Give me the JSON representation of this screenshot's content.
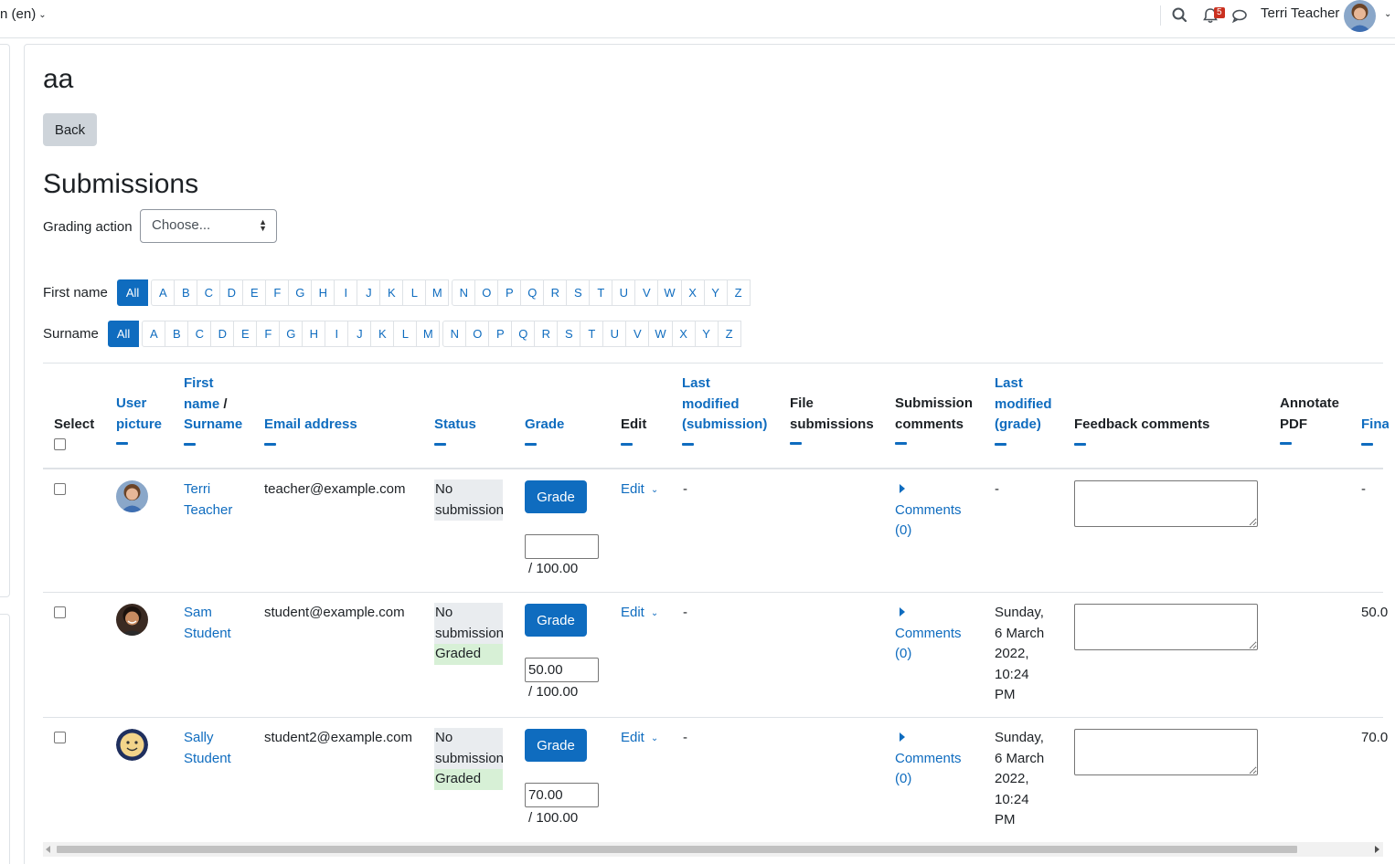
{
  "navbar": {
    "language": "n (en)",
    "notification_count": "5",
    "user_name": "Terri Teacher",
    "icons": [
      "search-icon",
      "bell-icon",
      "chat-icon",
      "chevron-down-icon"
    ]
  },
  "page": {
    "title": "aa",
    "back_label": "Back",
    "section_title": "Submissions",
    "grading_action_label": "Grading action",
    "grading_action_value": "Choose..."
  },
  "filters": {
    "first_name_label": "First name",
    "surname_label": "Surname",
    "all_label": "All",
    "letters": [
      "A",
      "B",
      "C",
      "D",
      "E",
      "F",
      "G",
      "H",
      "I",
      "J",
      "K",
      "L",
      "M",
      "N",
      "O",
      "P",
      "Q",
      "R",
      "S",
      "T",
      "U",
      "V",
      "W",
      "X",
      "Y",
      "Z"
    ]
  },
  "table": {
    "headers": {
      "select": "Select",
      "user_picture": [
        "User",
        "picture"
      ],
      "name": [
        "First",
        "name",
        "/",
        "Surname"
      ],
      "email": "Email address",
      "status": "Status",
      "grade": "Grade",
      "edit": "Edit",
      "last_mod_sub": [
        "Last",
        "modified",
        "(submission)"
      ],
      "file_sub": [
        "File",
        "submissions"
      ],
      "sub_comments": [
        "Submission",
        "comments"
      ],
      "last_mod_grade": [
        "Last",
        "modified",
        "(grade)"
      ],
      "feedback": "Feedback comments",
      "annotate": [
        "Annotate",
        "PDF"
      ],
      "final": "Fina"
    },
    "grade_button_label": "Grade",
    "edit_label": "Edit",
    "comments_label": "Comments",
    "comments_count": "(0)",
    "rows": [
      {
        "first": "Terri",
        "last": "Teacher",
        "email": "teacher@example.com",
        "status1": "No",
        "status2": "submission",
        "graded": "",
        "grade_value": "",
        "grade_max": "/ 100.00",
        "last_mod_sub": "-",
        "last_mod_grade": [
          "-"
        ],
        "final": "-"
      },
      {
        "first": "Sam",
        "last": "Student",
        "email": "student@example.com",
        "status1": "No",
        "status2": "submission",
        "graded": "Graded",
        "grade_value": "50.00",
        "grade_max": "/ 100.00",
        "last_mod_sub": "-",
        "last_mod_grade": [
          "Sunday,",
          "6 March",
          "2022,",
          "10:24",
          "PM"
        ],
        "final": "50.0"
      },
      {
        "first": "Sally",
        "last": "Student",
        "email": "student2@example.com",
        "status1": "No",
        "status2": "submission",
        "graded": "Graded",
        "grade_value": "70.00",
        "grade_max": "/ 100.00",
        "last_mod_sub": "-",
        "last_mod_grade": [
          "Sunday,",
          "6 March",
          "2022,",
          "10:24",
          "PM"
        ],
        "final": "70.0"
      }
    ]
  },
  "colors": {
    "brand": "#0f6cbf",
    "status_no_bg": "#e9ecef",
    "status_graded_bg": "#d7f0d6",
    "badge": "#ca3120"
  }
}
